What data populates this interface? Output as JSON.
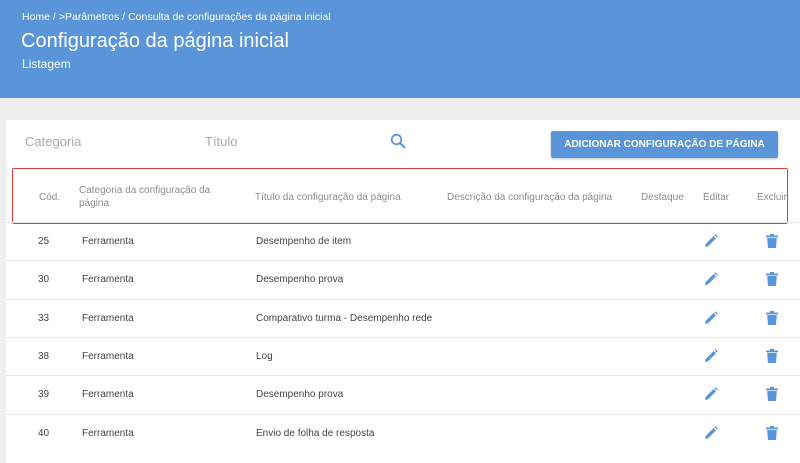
{
  "breadcrumb": [
    "Home /",
    ">Parâmetros /",
    "Consulta de configurações da página inicial"
  ],
  "header": {
    "title": "Configuração da página inicial",
    "subtitle": "Listagem"
  },
  "filters": {
    "category_placeholder": "Categoria",
    "title_placeholder": "Título"
  },
  "add_button_label": "ADICIONAR CONFIGURAÇÃO DE PÁGINA",
  "table": {
    "columns": {
      "code": "Cód.",
      "category": "Categoria da configuração da página",
      "title": "Título da configuração da página",
      "description": "Descrição da configuração da página",
      "highlight": "Destaque",
      "edit": "Editar",
      "delete": "Excluir"
    },
    "rows": [
      {
        "code": "25",
        "category": "Ferramenta",
        "title": "Desempenho de item"
      },
      {
        "code": "30",
        "category": "Ferramenta",
        "title": "Desempenho prova"
      },
      {
        "code": "33",
        "category": "Ferramenta",
        "title": "Comparativo turma - Desempenho rede"
      },
      {
        "code": "38",
        "category": "Ferramenta",
        "title": "Log"
      },
      {
        "code": "39",
        "category": "Ferramenta",
        "title": "Desempenho prova"
      },
      {
        "code": "40",
        "category": "Ferramenta",
        "title": "Envio de folha de resposta"
      }
    ]
  },
  "colors": {
    "accent": "#5a95d9",
    "highlight_border": "#e53b3b"
  },
  "icons": {
    "search": "search-icon",
    "edit": "pencil-icon",
    "delete": "trash-icon"
  }
}
